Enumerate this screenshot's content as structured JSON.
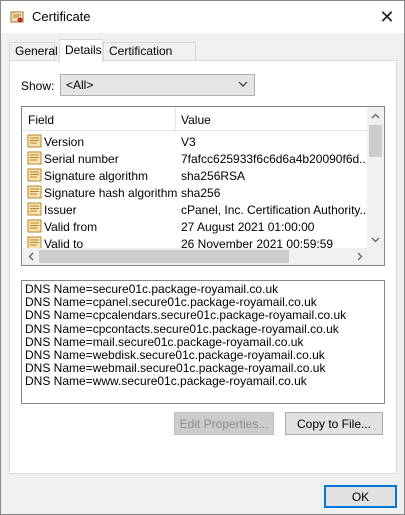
{
  "window": {
    "title": "Certificate"
  },
  "tabs": [
    {
      "label": "General"
    },
    {
      "label": "Details"
    },
    {
      "label": "Certification Path"
    }
  ],
  "show": {
    "label": "Show:",
    "value": "<All>"
  },
  "list": {
    "columns": [
      "Field",
      "Value"
    ],
    "rows": [
      {
        "field": "Version",
        "value": "V3"
      },
      {
        "field": "Serial number",
        "value": "7fafcc625933f6c6d6a4b20090f6d..."
      },
      {
        "field": "Signature algorithm",
        "value": "sha256RSA"
      },
      {
        "field": "Signature hash algorithm",
        "value": "sha256"
      },
      {
        "field": "Issuer",
        "value": "cPanel, Inc. Certification Authority..."
      },
      {
        "field": "Valid from",
        "value": "27 August 2021 01:00:00"
      },
      {
        "field": "Valid to",
        "value": "26 November 2021 00:59:59"
      }
    ]
  },
  "details": [
    "DNS Name=secure01c.package-royamail.co.uk",
    "DNS Name=cpanel.secure01c.package-royamail.co.uk",
    "DNS Name=cpcalendars.secure01c.package-royamail.co.uk",
    "DNS Name=cpcontacts.secure01c.package-royamail.co.uk",
    "DNS Name=mail.secure01c.package-royamail.co.uk",
    "DNS Name=webdisk.secure01c.package-royamail.co.uk",
    "DNS Name=webmail.secure01c.package-royamail.co.uk",
    "DNS Name=www.secure01c.package-royamail.co.uk"
  ],
  "buttons": {
    "edit_properties": "Edit Properties...",
    "copy_to_file": "Copy to File...",
    "ok": "OK"
  }
}
